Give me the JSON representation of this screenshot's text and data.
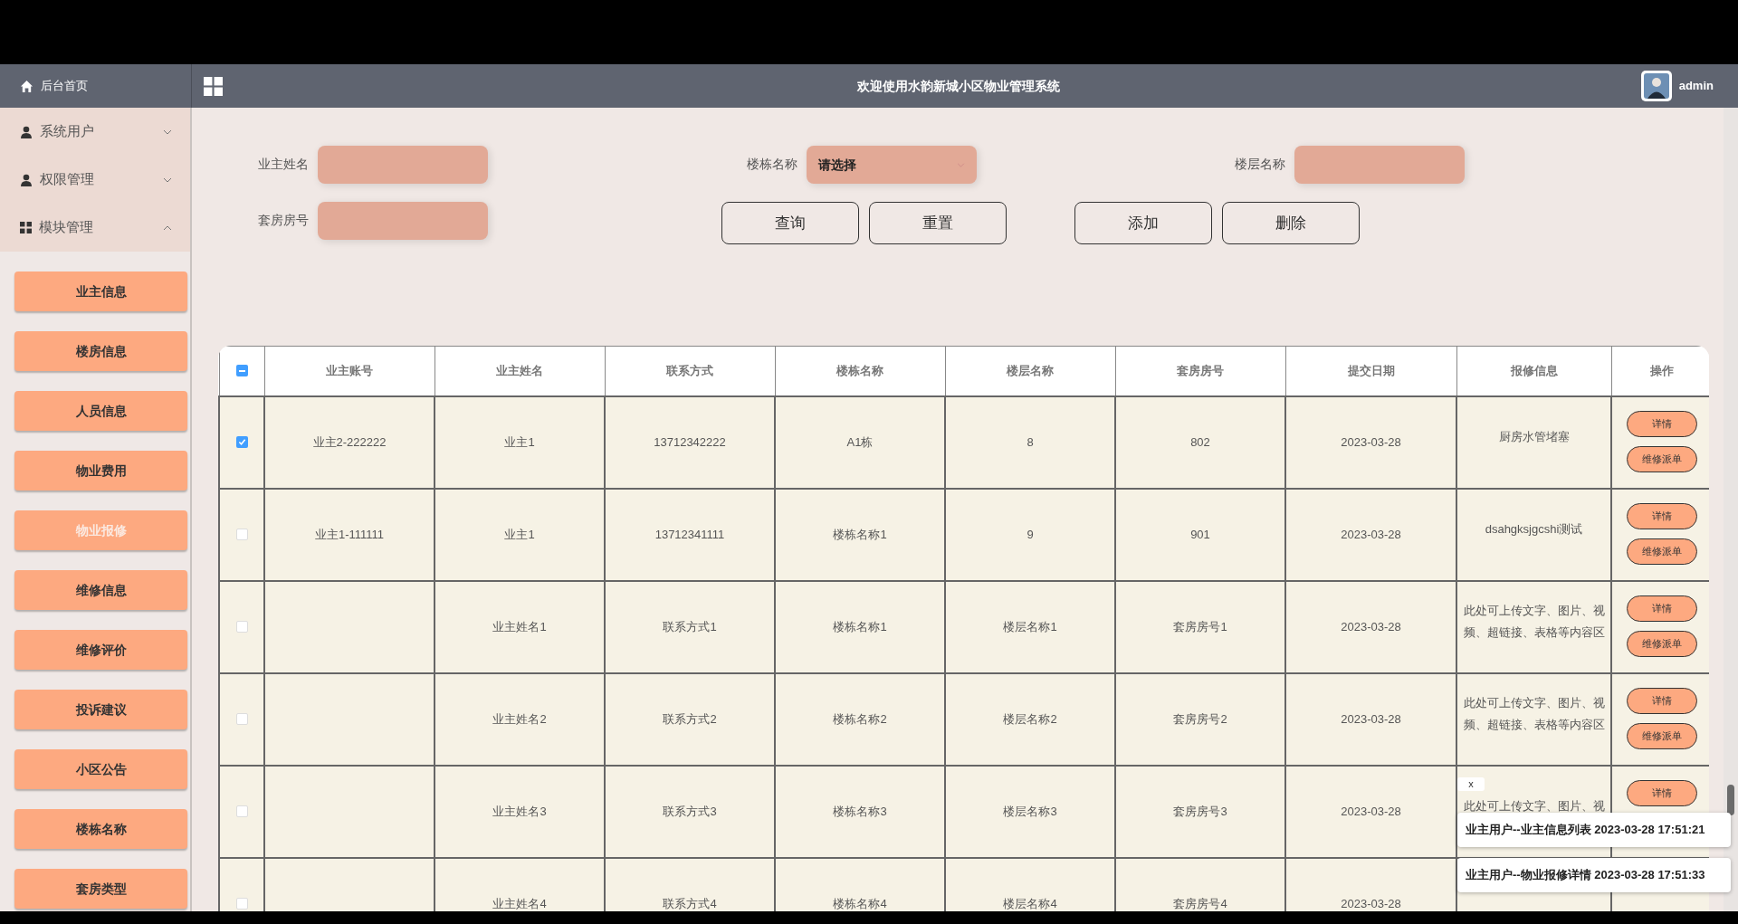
{
  "header": {
    "home": "后台首页",
    "title": "欢迎使用水韵新城小区物业管理系统",
    "user": "admin"
  },
  "sidebar": {
    "groups": [
      {
        "label": "系统用户",
        "kind": "person",
        "expanded": false
      },
      {
        "label": "权限管理",
        "kind": "person",
        "expanded": false
      },
      {
        "label": "模块管理",
        "kind": "grid",
        "expanded": true
      }
    ],
    "items": [
      {
        "label": "业主信息",
        "selected": false
      },
      {
        "label": "楼房信息",
        "selected": false
      },
      {
        "label": "人员信息",
        "selected": false
      },
      {
        "label": "物业费用",
        "selected": false
      },
      {
        "label": "物业报修",
        "selected": true
      },
      {
        "label": "维修信息",
        "selected": false
      },
      {
        "label": "维修评价",
        "selected": false
      },
      {
        "label": "投诉建议",
        "selected": false
      },
      {
        "label": "小区公告",
        "selected": false
      },
      {
        "label": "楼栋名称",
        "selected": false
      },
      {
        "label": "套房类型",
        "selected": false
      }
    ]
  },
  "search": {
    "fields": [
      {
        "label": "业主姓名",
        "kind": "input"
      },
      {
        "label": "楼栋名称",
        "kind": "select",
        "placeholder": "请选择"
      },
      {
        "label": "楼层名称",
        "kind": "input"
      },
      {
        "label": "套房房号",
        "kind": "input"
      }
    ],
    "buttons": [
      "查询",
      "重置",
      "添加",
      "删除"
    ]
  },
  "table": {
    "select_all": {
      "indeterminate": true
    },
    "columns": [
      "业主账号",
      "业主姓名",
      "联系方式",
      "楼栋名称",
      "楼层名称",
      "套房房号",
      "提交日期",
      "报修信息",
      "操作"
    ],
    "rows": [
      {
        "checked": true,
        "cells": [
          "业主2-222222",
          "业主1",
          "13712342222",
          "A1栋",
          "8",
          "802",
          "2023-03-28",
          "厨房水管堵塞"
        ],
        "actions": [
          "详情",
          "维修派单"
        ]
      },
      {
        "checked": false,
        "cells": [
          "业主1-111111",
          "业主1",
          "13712341111",
          "楼栋名称1",
          "9",
          "901",
          "2023-03-28",
          "dsahgksjgcshi测试"
        ],
        "actions": [
          "详情",
          "维修派单"
        ]
      },
      {
        "checked": false,
        "cells": [
          "",
          "业主姓名1",
          "联系方式1",
          "楼栋名称1",
          "楼层名称1",
          "套房房号1",
          "2023-03-28",
          "此处可上传文字、图片、视频、超链接、表格等内容区"
        ],
        "actions": [
          "详情",
          "维修派单"
        ]
      },
      {
        "checked": false,
        "cells": [
          "",
          "业主姓名2",
          "联系方式2",
          "楼栋名称2",
          "楼层名称2",
          "套房房号2",
          "2023-03-28",
          "此处可上传文字、图片、视频、超链接、表格等内容区"
        ],
        "actions": [
          "详情",
          "维修派单"
        ]
      },
      {
        "checked": false,
        "cells": [
          "",
          "业主姓名3",
          "联系方式3",
          "楼栋名称3",
          "楼层名称3",
          "套房房号3",
          "2023-03-28",
          "此处可上传文字、图片、视"
        ],
        "actions": [
          "详情"
        ]
      },
      {
        "checked": false,
        "cells": [
          "",
          "业主姓名4",
          "联系方式4",
          "楼栋名称4",
          "楼层名称4",
          "套房房号4",
          "2023-03-28",
          ""
        ],
        "actions": []
      }
    ]
  },
  "notifications": {
    "close": "x",
    "items": [
      "业主用户--业主信息列表 2023-03-28 17:51:21",
      "业主用户--物业报修详情 2023-03-28 17:51:33"
    ]
  }
}
